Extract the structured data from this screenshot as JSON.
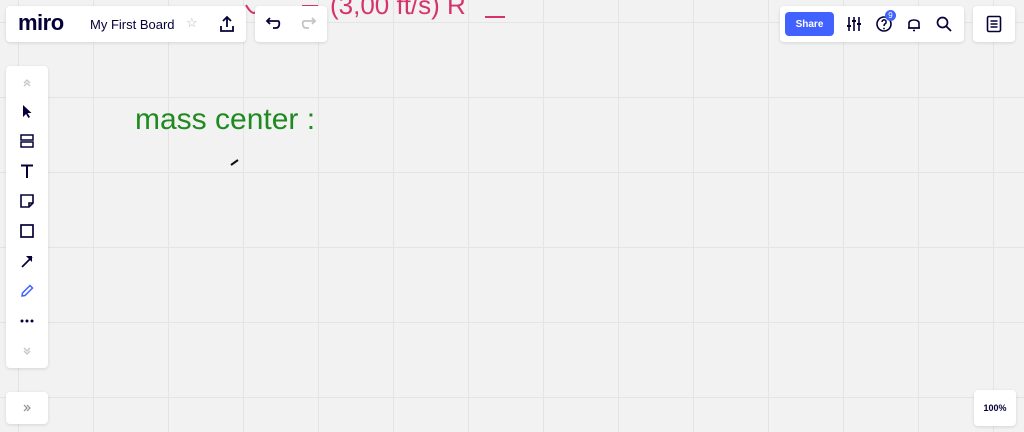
{
  "app": {
    "logo_text": "miro",
    "board_title": "My First Board"
  },
  "header": {
    "share_label": "Share",
    "notifications_badge": "9"
  },
  "zoom": {
    "label": "100%"
  },
  "canvas": {
    "handwriting_top": "(3,00 ft/s) R",
    "handwriting_main": "mass center :"
  },
  "colors": {
    "accent": "#4262ff",
    "ink_green": "#1f8a1f",
    "ink_pink": "#d6336c",
    "text_dark": "#050038"
  },
  "icons": {
    "toolbar": [
      "collapse-up-icon",
      "select-icon",
      "frame-icon",
      "text-icon",
      "sticky-note-icon",
      "shape-icon",
      "connector-icon",
      "pen-icon",
      "more-icon",
      "collapse-down-icon"
    ]
  }
}
